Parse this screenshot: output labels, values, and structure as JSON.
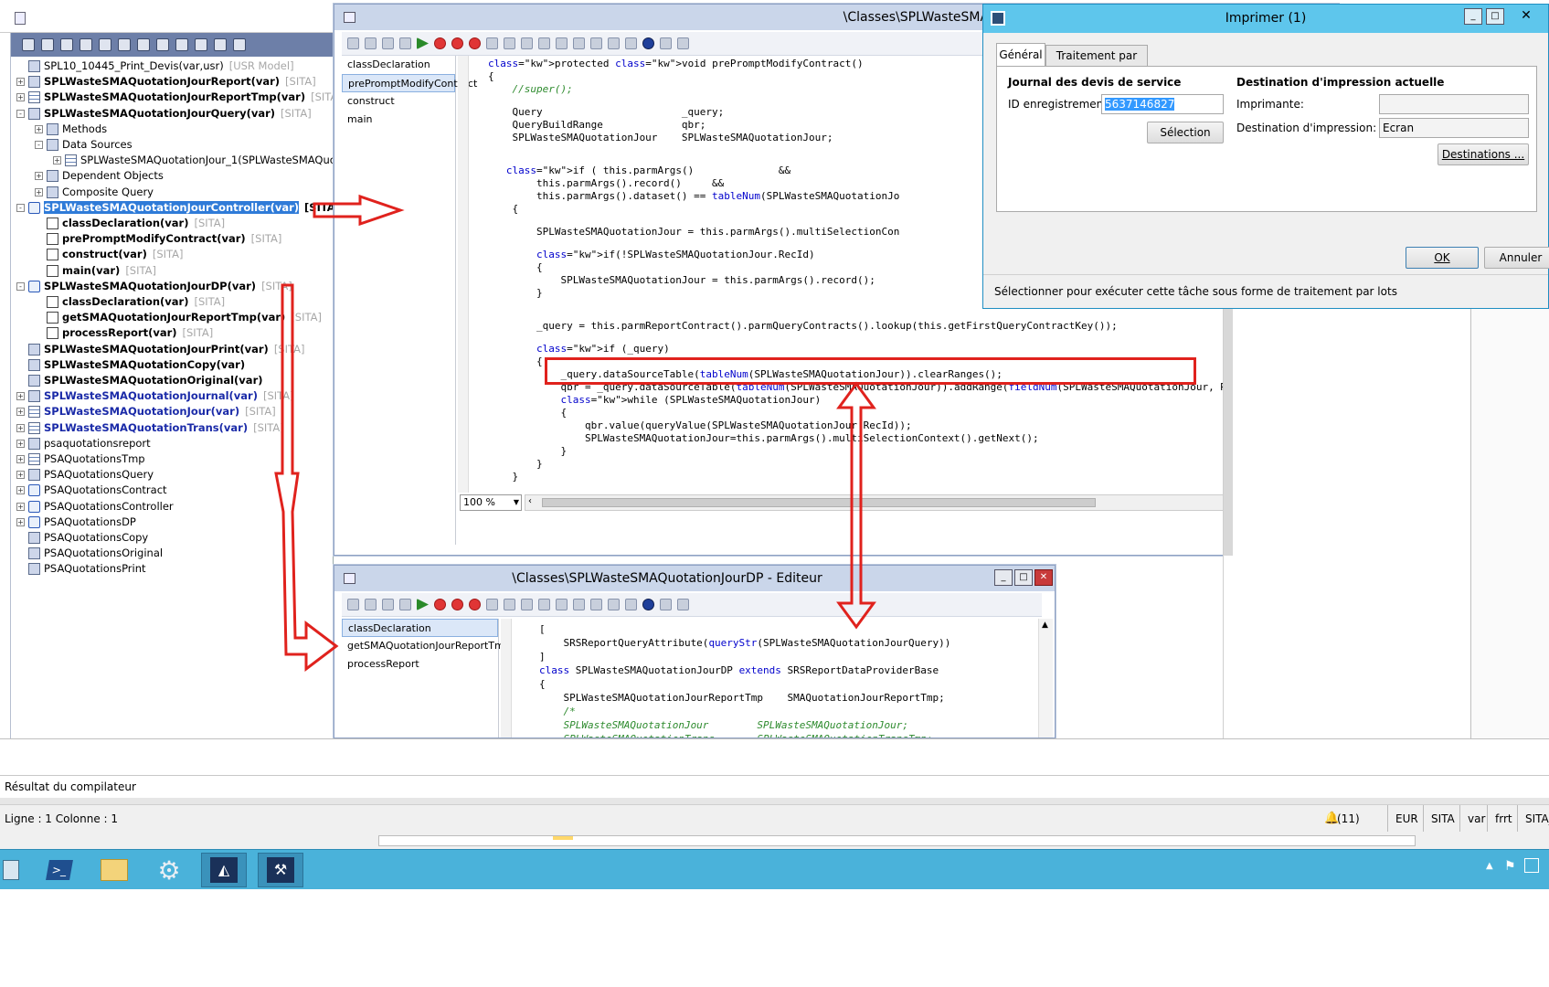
{
  "aot": {
    "tree": [
      {
        "label": "SPL10_10445_Print_Devis(var,usr)",
        "layer": "[USR Model]",
        "bold": false,
        "blue": false,
        "expander": "",
        "icon": "project"
      },
      {
        "label": "SPLWasteSMAQuotationJourReport(var)",
        "layer": "[SITA]",
        "bold": true,
        "blue": false,
        "expander": "+",
        "icon": "report"
      },
      {
        "label": "SPLWasteSMAQuotationJourReportTmp(var)",
        "layer": "[SITA]",
        "bold": true,
        "blue": false,
        "expander": "+",
        "icon": "table"
      },
      {
        "label": "SPLWasteSMAQuotationJourQuery(var)",
        "layer": "[SITA]",
        "bold": true,
        "blue": false,
        "expander": "-",
        "icon": "query"
      },
      {
        "label": "Methods",
        "layer": "",
        "bold": false,
        "blue": false,
        "expander": "+",
        "icon": "folder"
      },
      {
        "label": "Data Sources",
        "layer": "",
        "bold": false,
        "blue": false,
        "expander": "-",
        "icon": "folder"
      },
      {
        "label": "SPLWasteSMAQuotationJour_1(SPLWasteSMAQuot",
        "layer": "",
        "bold": false,
        "blue": false,
        "expander": "+",
        "icon": "table"
      },
      {
        "label": "Dependent Objects",
        "layer": "",
        "bold": false,
        "blue": false,
        "expander": "+",
        "icon": "folder"
      },
      {
        "label": "Composite Query",
        "layer": "",
        "bold": false,
        "blue": false,
        "expander": "+",
        "icon": "folder"
      },
      {
        "label": "SPLWasteSMAQuotationJourController(var)",
        "layer": "[SITA]",
        "bold": true,
        "blue": false,
        "expander": "-",
        "icon": "class",
        "selected": true
      },
      {
        "label": "classDeclaration(var)",
        "layer": "[SITA]",
        "bold": true,
        "blue": false,
        "expander": "",
        "icon": "method"
      },
      {
        "label": "prePromptModifyContract(var)",
        "layer": "[SITA]",
        "bold": true,
        "blue": false,
        "expander": "",
        "icon": "method"
      },
      {
        "label": "construct(var)",
        "layer": "[SITA]",
        "bold": true,
        "blue": false,
        "expander": "",
        "icon": "method"
      },
      {
        "label": "main(var)",
        "layer": "[SITA]",
        "bold": true,
        "blue": false,
        "expander": "",
        "icon": "method"
      },
      {
        "label": "SPLWasteSMAQuotationJourDP(var)",
        "layer": "[SITA]",
        "bold": true,
        "blue": false,
        "expander": "-",
        "icon": "class"
      },
      {
        "label": "classDeclaration(var)",
        "layer": "[SITA]",
        "bold": true,
        "blue": false,
        "expander": "",
        "icon": "method"
      },
      {
        "label": "getSMAQuotationJourReportTmp(var)",
        "layer": "[SITA]",
        "bold": true,
        "blue": false,
        "expander": "",
        "icon": "method"
      },
      {
        "label": "processReport(var)",
        "layer": "[SITA]",
        "bold": true,
        "blue": false,
        "expander": "",
        "icon": "method"
      },
      {
        "label": "SPLWasteSMAQuotationJourPrint(var)",
        "layer": "[SITA]",
        "bold": true,
        "blue": false,
        "expander": "",
        "icon": "menuitem"
      },
      {
        "label": "SPLWasteSMAQuotationCopy(var)",
        "layer": "",
        "bold": true,
        "blue": false,
        "expander": "",
        "icon": "menuitem"
      },
      {
        "label": "SPLWasteSMAQuotationOriginal(var)",
        "layer": "",
        "bold": true,
        "blue": false,
        "expander": "",
        "icon": "menuitem"
      },
      {
        "label": "SPLWasteSMAQuotationJournal(var)",
        "layer": "[SITA]",
        "bold": true,
        "blue": true,
        "expander": "+",
        "icon": "menuitem"
      },
      {
        "label": "SPLWasteSMAQuotationJour(var)",
        "layer": "[SITA]",
        "bold": true,
        "blue": true,
        "expander": "+",
        "icon": "table"
      },
      {
        "label": "SPLWasteSMAQuotationTrans(var)",
        "layer": "[SITA]",
        "bold": true,
        "blue": true,
        "expander": "+",
        "icon": "table"
      },
      {
        "label": "psaquotationsreport",
        "layer": "",
        "bold": false,
        "blue": false,
        "expander": "+",
        "icon": "report"
      },
      {
        "label": "PSAQuotationsTmp",
        "layer": "",
        "bold": false,
        "blue": false,
        "expander": "+",
        "icon": "table"
      },
      {
        "label": "PSAQuotationsQuery",
        "layer": "",
        "bold": false,
        "blue": false,
        "expander": "+",
        "icon": "query"
      },
      {
        "label": "PSAQuotationsContract",
        "layer": "",
        "bold": false,
        "blue": false,
        "expander": "+",
        "icon": "class"
      },
      {
        "label": "PSAQuotationsController",
        "layer": "",
        "bold": false,
        "blue": false,
        "expander": "+",
        "icon": "class"
      },
      {
        "label": "PSAQuotationsDP",
        "layer": "",
        "bold": false,
        "blue": false,
        "expander": "+",
        "icon": "class"
      },
      {
        "label": "PSAQuotationsCopy",
        "layer": "",
        "bold": false,
        "blue": false,
        "expander": "",
        "icon": "menuitem"
      },
      {
        "label": "PSAQuotationsOriginal",
        "layer": "",
        "bold": false,
        "blue": false,
        "expander": "",
        "icon": "menuitem"
      },
      {
        "label": "PSAQuotationsPrint",
        "layer": "",
        "bold": false,
        "blue": false,
        "expander": "",
        "icon": "menuitem"
      }
    ]
  },
  "controller_editor": {
    "title": "\\Classes\\SPLWasteSMAQuotationJourController",
    "methods": [
      "classDeclaration",
      "prePromptModifyContract",
      "construct",
      "main"
    ],
    "selected_method": 1,
    "zoom": "100 %",
    "code": [
      {
        "t": "protected void prePromptModifyContract()",
        "k": "kwline"
      },
      {
        "t": "{",
        "k": ""
      },
      {
        "t": "    //super();",
        "k": "cm"
      },
      {
        "t": "",
        "k": ""
      },
      {
        "t": "    Query                       _query;",
        "k": ""
      },
      {
        "t": "    QueryBuildRange             qbr;",
        "k": ""
      },
      {
        "t": "    SPLWasteSMAQuotationJour    SPLWasteSMAQuotationJour;",
        "k": ""
      },
      {
        "t": "",
        "k": ""
      },
      {
        "t": "",
        "k": ""
      },
      {
        "t": "   if ( this.parmArgs()              &&",
        "k": "if"
      },
      {
        "t": "        this.parmArgs().record()     &&",
        "k": ""
      },
      {
        "t": "        this.parmArgs().dataset() == tableNum(SPLWasteSMAQuotationJo",
        "k": "tn"
      },
      {
        "t": "    {",
        "k": ""
      },
      {
        "t": "",
        "k": ""
      },
      {
        "t": "        SPLWasteSMAQuotationJour = this.parmArgs().multiSelectionCon",
        "k": ""
      },
      {
        "t": "",
        "k": ""
      },
      {
        "t": "        if(!SPLWasteSMAQuotationJour.RecId)",
        "k": ""
      },
      {
        "t": "        {",
        "k": ""
      },
      {
        "t": "            SPLWasteSMAQuotationJour = this.parmArgs().record();",
        "k": ""
      },
      {
        "t": "        }",
        "k": ""
      },
      {
        "t": "",
        "k": ""
      },
      {
        "t": "",
        "k": ""
      },
      {
        "t": "        _query = this.parmReportContract().parmQueryContracts().lookup(this.getFirstQueryContractKey());",
        "k": ""
      },
      {
        "t": "",
        "k": ""
      },
      {
        "t": "        if (_query)",
        "k": "if2"
      },
      {
        "t": "        {",
        "k": ""
      },
      {
        "t": "            _query.dataSourceTable(tableNum(SPLWasteSMAQuotationJour)).clearRanges();",
        "k": "tn2"
      },
      {
        "t": "            qbr = _query.dataSourceTable(tableNum(SPLWasteSMAQuotationJour)).addRange(fieldNum(SPLWasteSMAQuotationJour, RecId));",
        "k": "tn3"
      },
      {
        "t": "            while (SPLWasteSMAQuotationJour)",
        "k": "wh"
      },
      {
        "t": "            {",
        "k": ""
      },
      {
        "t": "                qbr.value(queryValue(SPLWasteSMAQuotationJour.RecId));",
        "k": ""
      },
      {
        "t": "                SPLWasteSMAQuotationJour=this.parmArgs().multiSelectionContext().getNext();",
        "k": ""
      },
      {
        "t": "            }",
        "k": ""
      },
      {
        "t": "        }",
        "k": ""
      },
      {
        "t": "    }",
        "k": ""
      }
    ]
  },
  "dp_editor": {
    "title": "\\Classes\\SPLWasteSMAQuotationJourDP - Editeur",
    "methods": [
      "classDeclaration",
      "getSMAQuotationJourReportTmp",
      "processReport"
    ],
    "selected_method": 0,
    "code": [
      {
        "t": "[",
        "k": ""
      },
      {
        "t": "    SRSReportQueryAttribute(queryStr(SPLWasteSMAQuotationJourQuery))",
        "k": "qs"
      },
      {
        "t": "]",
        "k": ""
      },
      {
        "t": "class SPLWasteSMAQuotationJourDP extends SRSReportDataProviderBase",
        "k": "cls"
      },
      {
        "t": "{",
        "k": ""
      },
      {
        "t": "    SPLWasteSMAQuotationJourReportTmp    SMAQuotationJourReportTmp;",
        "k": ""
      },
      {
        "t": "    /*",
        "k": "cm"
      },
      {
        "t": "    SPLWasteSMAQuotationJour        SPLWasteSMAQuotationJour;",
        "k": "cm"
      },
      {
        "t": "    SPLWasteSMAQuotationTrans       SPLWasteSMAQuotationTransTmp;",
        "k": "cm"
      }
    ]
  },
  "print_dialog": {
    "title": "Imprimer (1)",
    "tabs": [
      "Général",
      "Traitement par lots"
    ],
    "left_group_title": "Journal des devis de service",
    "id_label": "ID enregistrement:",
    "id_value": "5637146827",
    "selection_button": "Sélection",
    "right_group_title": "Destination d'impression actuelle",
    "printer_label": "Imprimante:",
    "printer_value": "",
    "destination_label": "Destination d'impression:",
    "destination_value": "Ecran",
    "destinations_button": "Destinations ...",
    "ok_button": "OK",
    "cancel_button": "Annuler",
    "status_text": "Sélectionner pour exécuter cette tâche sous forme de traitement par lots"
  },
  "compiler_panel": {
    "label": "Résultat du compilateur"
  },
  "statusbar": {
    "position": "Ligne : 1 Colonne : 1",
    "notifications": "(11)",
    "currency": "EUR",
    "company": "SITA",
    "layer": "var",
    "language": "frrt",
    "model": "SITA_"
  },
  "colors": {
    "highlight_red": "#e0221d",
    "selection_blue": "#2f7bd8",
    "taskbar": "#4ab2da"
  }
}
